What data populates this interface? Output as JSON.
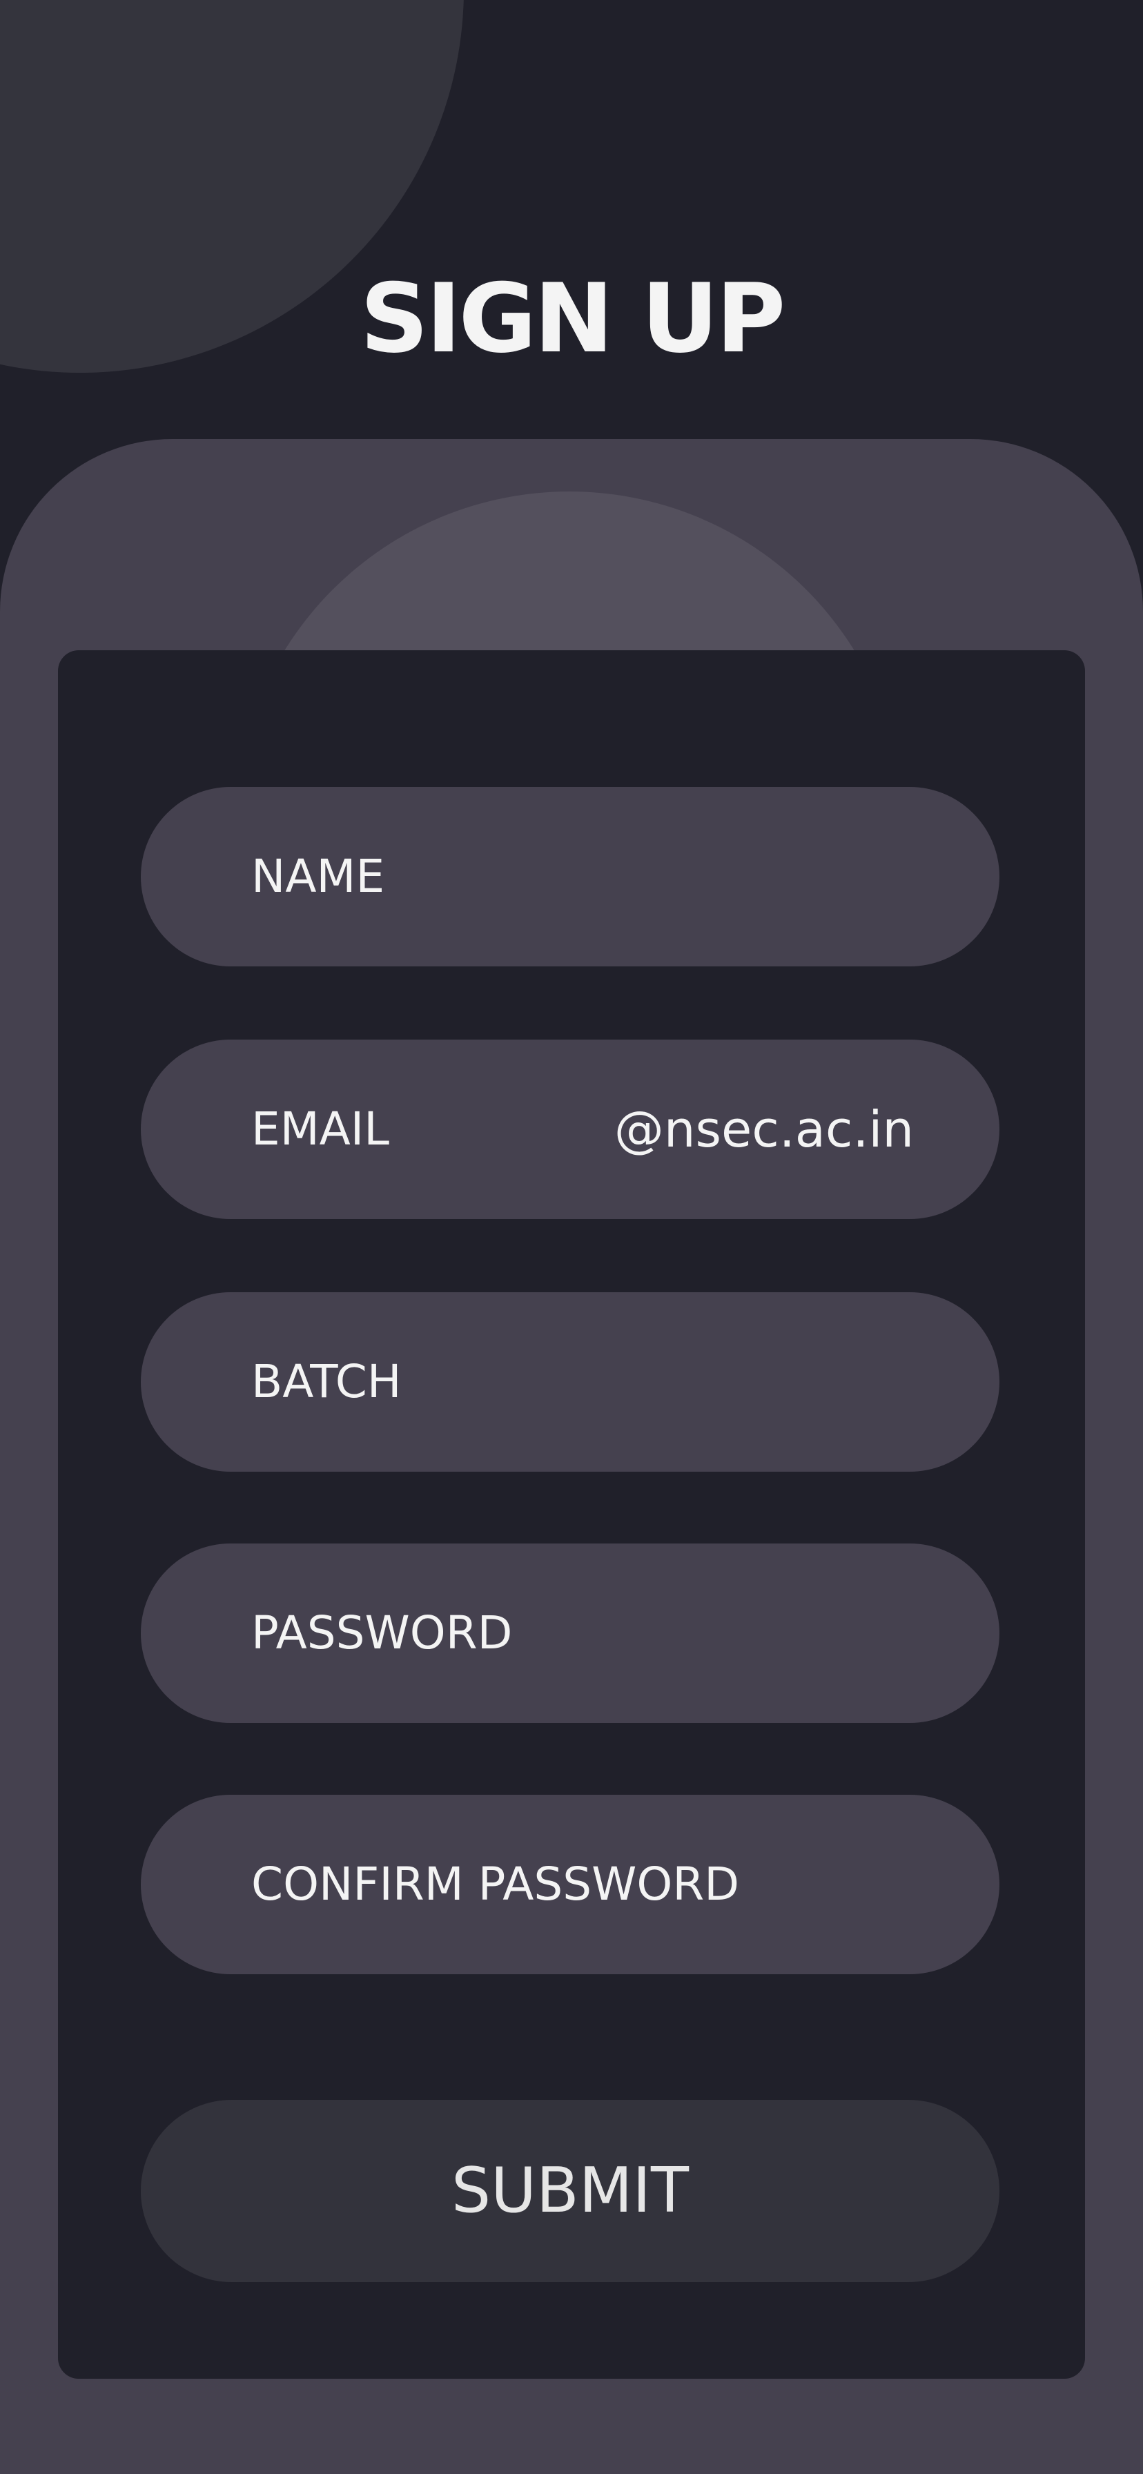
{
  "header": {
    "title": "SIGN UP"
  },
  "form": {
    "fields": [
      {
        "label": "NAME",
        "suffix": ""
      },
      {
        "label": "EMAIL",
        "suffix": "@nsec.ac.in"
      },
      {
        "label": "BATCH",
        "suffix": ""
      },
      {
        "label": "PASSWORD",
        "suffix": ""
      },
      {
        "label": "CONFIRM PASSWORD",
        "suffix": ""
      }
    ],
    "submit_label": "SUBMIT"
  },
  "colors": {
    "background": "#20202a",
    "panel": "#45414f",
    "field": "#45414f",
    "button": "#33333c",
    "text": "#f4f4f4"
  }
}
